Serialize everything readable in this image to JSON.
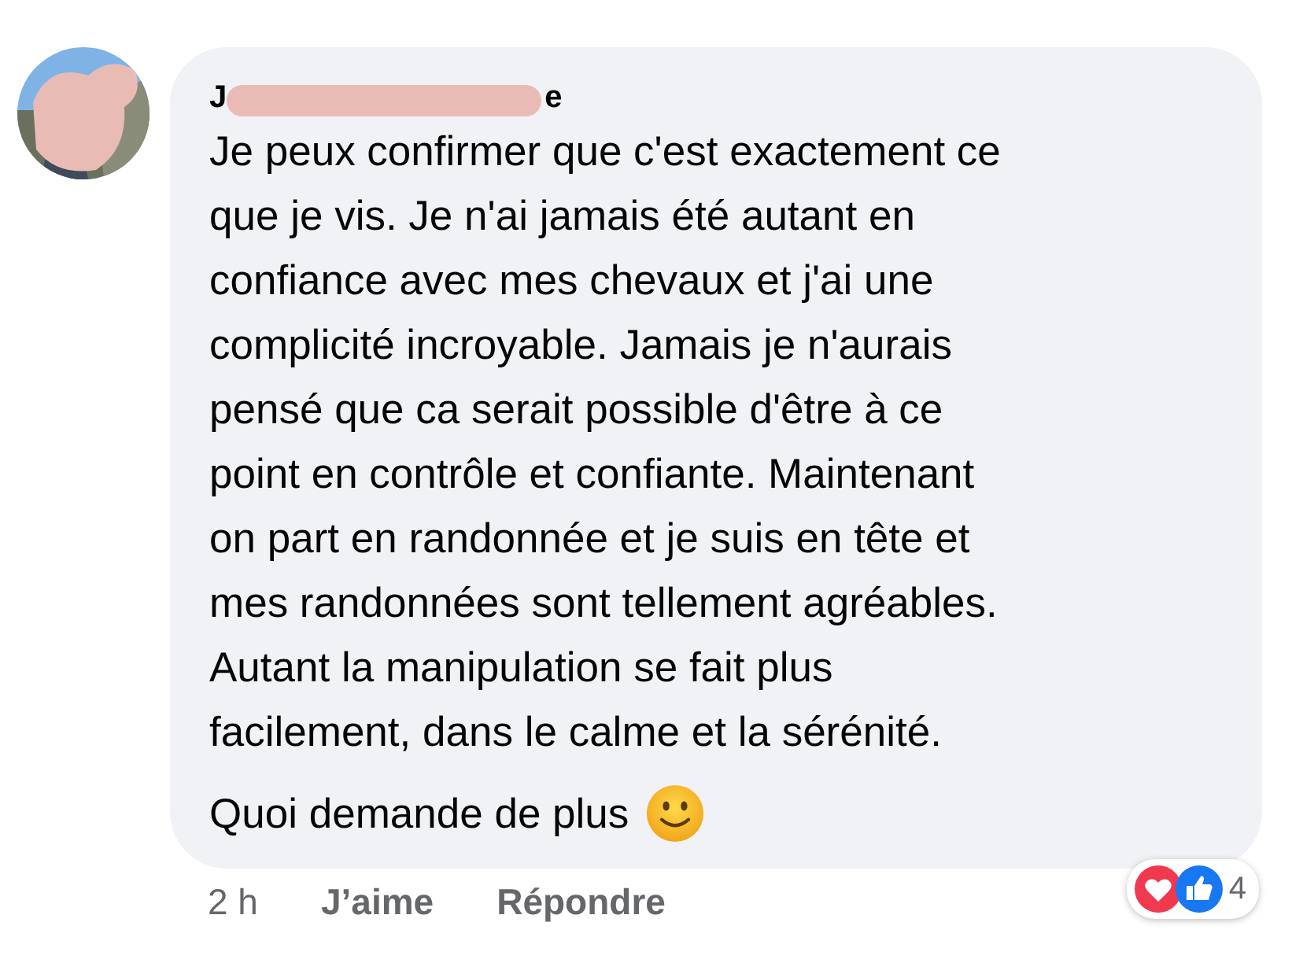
{
  "comment": {
    "author_start": "J",
    "author_end": "e",
    "text": "Je peux confirmer que c'est exactement ce\nque je vis. Je n'ai jamais été autant en\nconfiance avec mes chevaux et j'ai une\ncomplicité incroyable. Jamais je n'aurais\npensé que ca serait possible d'être à ce\npoint en contrôle et confiante. Maintenant\non part en randonnée et je suis en tête et\nmes randonnées sont tellement agréables.\nAutant la manipulation se fait plus\nfacilement, dans le calme et la sérénité.",
    "closing": "Quoi demande de plus",
    "time": "2 h",
    "actions": [
      "J’aime",
      "Répondre"
    ],
    "reaction_count": "4"
  }
}
